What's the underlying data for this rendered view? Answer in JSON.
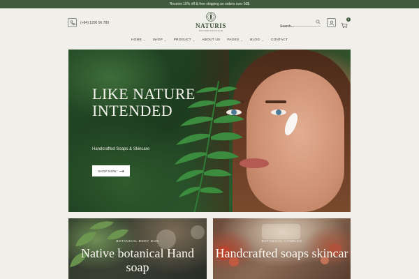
{
  "topbar": {
    "text": "Receive 10% off & free shipping on orders over 50$"
  },
  "header": {
    "phone": "(+84) 1200 56 789",
    "logo_name": "NATURIS",
    "logo_sub": "NATURE BOUTIQUE",
    "search_placeholder": "Search...",
    "cart_count": "0"
  },
  "nav": {
    "items": [
      {
        "label": "HOME",
        "dropdown": true
      },
      {
        "label": "SHOP",
        "dropdown": true
      },
      {
        "label": "PRODUCT",
        "dropdown": true
      },
      {
        "label": "ABOUT US",
        "dropdown": false
      },
      {
        "label": "PAGES",
        "dropdown": true
      },
      {
        "label": "BLOG",
        "dropdown": true
      },
      {
        "label": "CONTACT",
        "dropdown": false
      }
    ],
    "caret": "⌄"
  },
  "hero": {
    "title": "LIKE NATURE INTENDED",
    "subtitle": "Handcrafted Soaps & Skincare",
    "button_label": "SHOP NOW"
  },
  "cards": [
    {
      "tag": "BOTANICAL BODY DUO",
      "title": "Native botanical Hand soap"
    },
    {
      "tag": "BOTANICAL CANDLES",
      "title": "Handcrafted soaps skincar"
    }
  ],
  "colors": {
    "brand_green": "#3f5a3c",
    "background": "#f1efea"
  }
}
